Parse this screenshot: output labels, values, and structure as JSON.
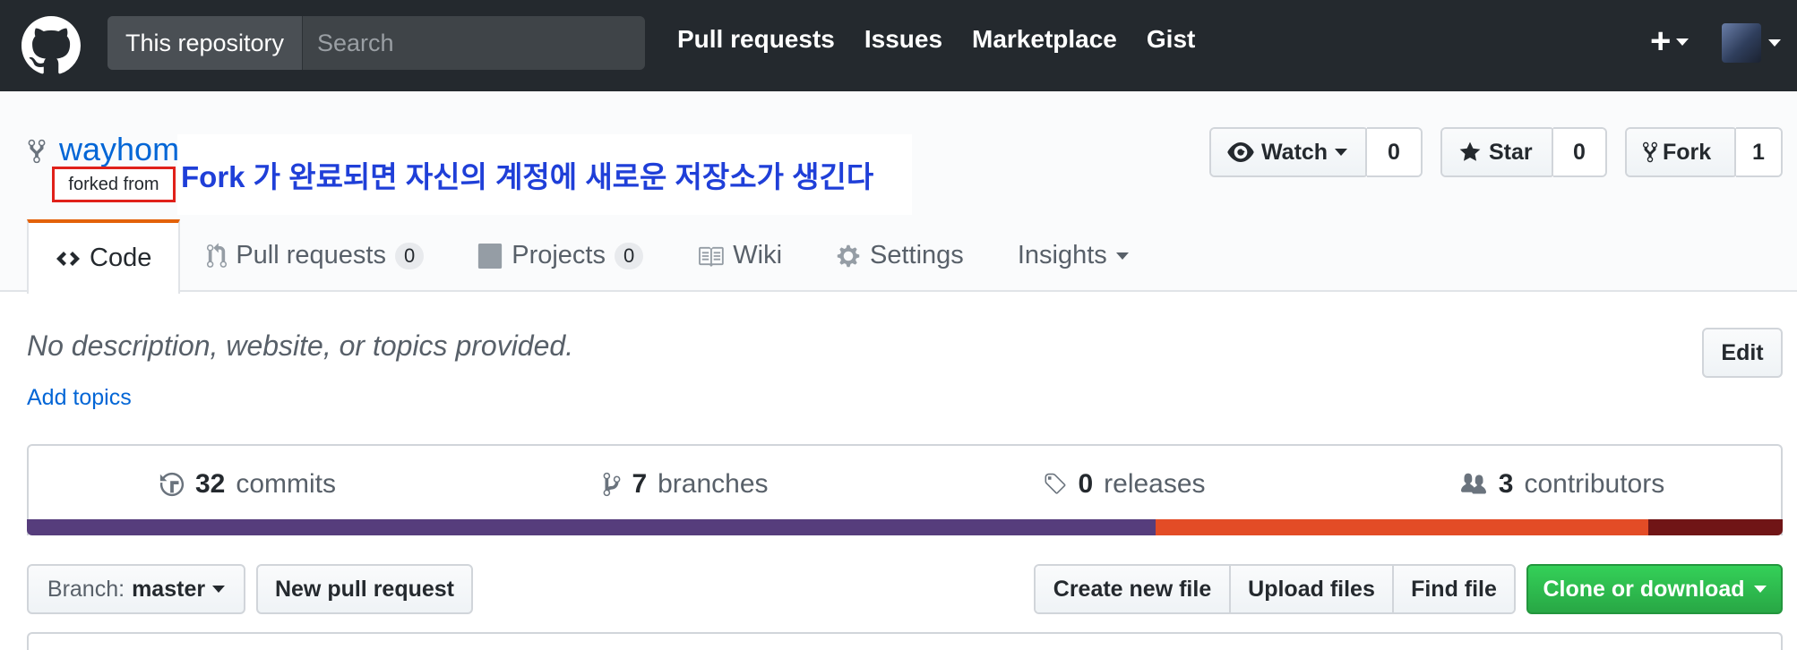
{
  "header": {
    "scope_label": "This repository",
    "search_placeholder": "Search",
    "nav": [
      "Pull requests",
      "Issues",
      "Marketplace",
      "Gist"
    ],
    "plus_label": "+"
  },
  "repo": {
    "name": "wayhom",
    "forked_from_label": "forked from",
    "annotation": "Fork 가 완료되면 자신의 계정에 새로운 저장소가 생긴다",
    "watch": {
      "label": "Watch",
      "count": "0"
    },
    "star": {
      "label": "Star",
      "count": "0"
    },
    "fork": {
      "label": "Fork",
      "count": "1"
    }
  },
  "tabs": [
    {
      "label": "Code",
      "count": "",
      "icon": "code-icon"
    },
    {
      "label": "Pull requests",
      "count": "0",
      "icon": "pull-request-icon"
    },
    {
      "label": "Projects",
      "count": "0",
      "icon": "project-icon"
    },
    {
      "label": "Wiki",
      "count": "",
      "icon": "book-icon"
    },
    {
      "label": "Settings",
      "count": "",
      "icon": "gear-icon"
    },
    {
      "label": "Insights",
      "count": "",
      "icon": "chevron-down-icon"
    }
  ],
  "description": "No description, website, or topics provided.",
  "add_topics": "Add topics",
  "edit_label": "Edit",
  "summary": [
    {
      "count": "32",
      "label": "commits",
      "icon": "history-icon"
    },
    {
      "count": "7",
      "label": "branches",
      "icon": "branch-icon"
    },
    {
      "count": "0",
      "label": "releases",
      "icon": "tag-icon"
    },
    {
      "count": "3",
      "label": "contributors",
      "icon": "people-icon"
    }
  ],
  "language_bar": {
    "colors": [
      "#563d7c",
      "#e34c26",
      "#701516"
    ]
  },
  "toolbar": {
    "branch_prefix": "Branch:",
    "branch_name": "master",
    "new_pr": "New pull request",
    "create_file": "Create new file",
    "upload_files": "Upload files",
    "find_file": "Find file",
    "clone": "Clone or download"
  },
  "colors": {
    "header_bg": "#24292e",
    "link": "#0366d6",
    "annotation": "#1f3fd8",
    "highlight_box": "#e0211a",
    "tab_accent": "#e36209",
    "clone_green": "#28a745"
  }
}
